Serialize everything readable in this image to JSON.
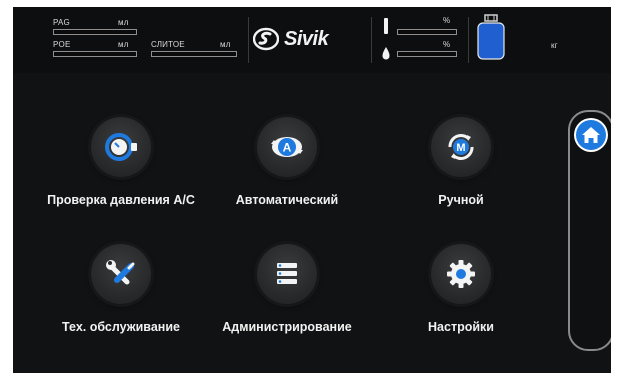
{
  "header": {
    "pag_label": "PAG",
    "pag_unit": "мл",
    "poe_label": "POE",
    "poe_unit": "мл",
    "uv_label": "СЛИТОЕ",
    "uv_unit": "мл",
    "brand": "Sivik",
    "percent_top": "%",
    "percent_bottom": "%",
    "kg_unit": "кг",
    "colors": {
      "tank": "#1f5fd0",
      "accent": "#1f7ae0"
    }
  },
  "menu": {
    "items": [
      {
        "label": "Проверка давления А/С",
        "icon": "pressure-gauge-icon"
      },
      {
        "label": "Автоматический",
        "icon": "auto-mode-icon"
      },
      {
        "label": "Ручной",
        "icon": "manual-mode-icon"
      },
      {
        "label": "Тех. обслуживание",
        "icon": "wrench-screwdriver-icon"
      },
      {
        "label": "Администрирование",
        "icon": "list-icon"
      },
      {
        "label": "Настройки",
        "icon": "gear-icon"
      }
    ]
  },
  "side": {
    "icon": "home-icon"
  }
}
